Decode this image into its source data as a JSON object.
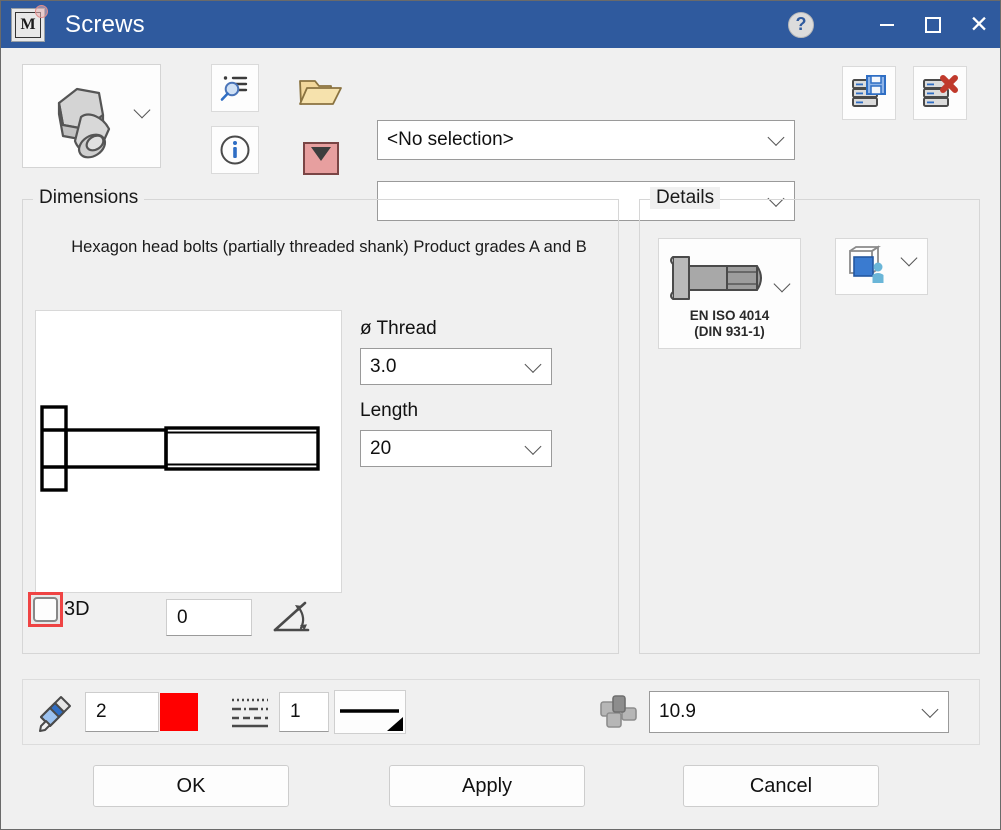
{
  "window": {
    "title": "Screws",
    "logo_letter": "M",
    "logo_icon": "app-logo-icon",
    "help_label": "?",
    "minimize_label": "Minimize",
    "maximize_label": "Maximize",
    "close_label": "Close",
    "titlebar_color": "#2f5a9e"
  },
  "toolbar": {
    "part_thumbnail_icon": "hex-bolt-3d-icon",
    "browse_parts_icon": "search-list-icon",
    "info_icon": "info-icon",
    "open_folder_icon": "open-folder-icon",
    "collapse_icon": "red-dropdown-icon",
    "save_to_database_icon": "save-database-icon",
    "delete_from_database_icon": "delete-database-icon",
    "selection_combo": {
      "value": "<No selection>",
      "placeholder": "<No selection>"
    },
    "variant_combo": {
      "value": "",
      "placeholder": ""
    }
  },
  "dimensions": {
    "group_title": "Dimensions",
    "description": "Hexagon head bolts (partially threaded shank) Product grades A and B",
    "preview_icon": "bolt-side-view-drawing",
    "thread_label": "ø Thread",
    "thread_value": "3.0",
    "length_label": "Length",
    "length_value": "20",
    "three_d_label": "3D",
    "three_d_checked": false,
    "angle_value": "0",
    "angle_icon": "angle-icon",
    "highlight_color": "#ef4444"
  },
  "details": {
    "group_title": "Details",
    "standard_icon": "hex-bolt-side-icon",
    "standard_label_line1": "EN ISO 4014",
    "standard_label_line2": "(DIN 931-1)",
    "view_icon": "view-representation-icon"
  },
  "properties": {
    "pen_icon": "pen-icon",
    "pen_value": "2",
    "color_value": "#ff0000",
    "color_swatch_name": "color-swatch",
    "linetype_icon": "line-type-icon",
    "linetype_value": "1",
    "lineweight_icon": "line-weight-preview",
    "material_icon": "parts-group-icon",
    "material_value": "10.9"
  },
  "footer": {
    "ok_label": "OK",
    "apply_label": "Apply",
    "cancel_label": "Cancel"
  }
}
